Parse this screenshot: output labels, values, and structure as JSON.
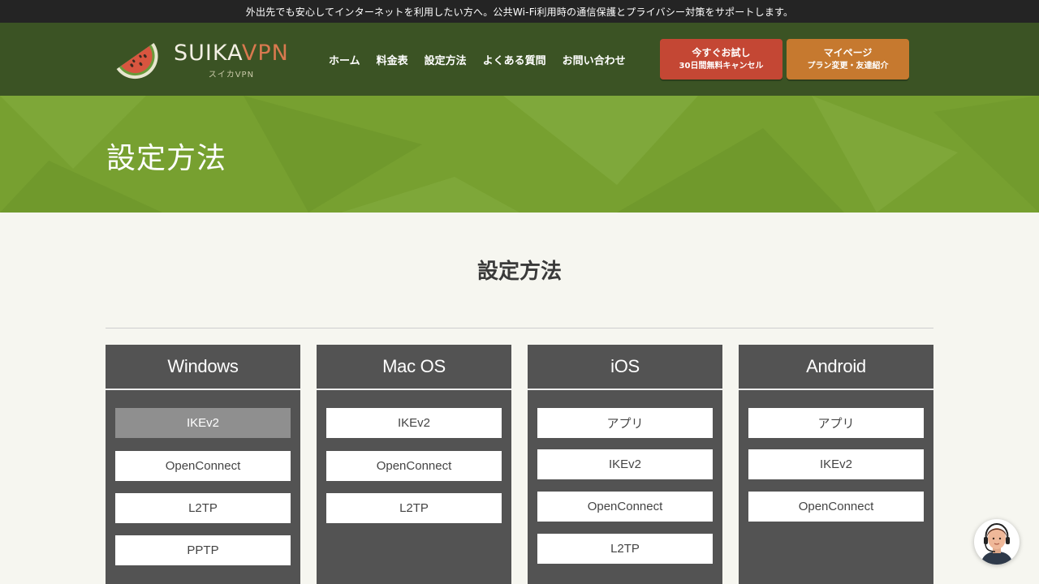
{
  "topbar": {
    "message": "外出先でも安心してインターネットを利用したい方へ。公共Wi-Fi利用時の通信保護とプライバシー対策をサポートします。"
  },
  "logo": {
    "main_a": "SUIKA",
    "main_b": "VPN",
    "sub": "スイカVPN"
  },
  "nav": {
    "items": [
      "ホーム",
      "料金表",
      "設定方法",
      "よくある質問",
      "お問い合わせ"
    ]
  },
  "cta": {
    "trial": {
      "line1": "今すぐお試し",
      "line2": "30日間無料キャンセル"
    },
    "mypage": {
      "line1": "マイページ",
      "line2": "プラン変更・友達紹介"
    }
  },
  "hero": {
    "title": "設定方法"
  },
  "section": {
    "title": "設定方法"
  },
  "platforms": [
    {
      "name": "Windows",
      "items": [
        "IKEv2",
        "OpenConnect",
        "L2TP",
        "PPTP"
      ]
    },
    {
      "name": "Mac OS",
      "items": [
        "IKEv2",
        "OpenConnect",
        "L2TP"
      ]
    },
    {
      "name": "iOS",
      "items": [
        "アプリ",
        "IKEv2",
        "OpenConnect",
        "L2TP"
      ]
    },
    {
      "name": "Android",
      "items": [
        "アプリ",
        "IKEv2",
        "OpenConnect"
      ]
    }
  ],
  "colors": {
    "header": "#3b5324",
    "hero": "#77a030",
    "trial": "#c44734",
    "mypage": "#c6792f",
    "column": "#535353"
  }
}
